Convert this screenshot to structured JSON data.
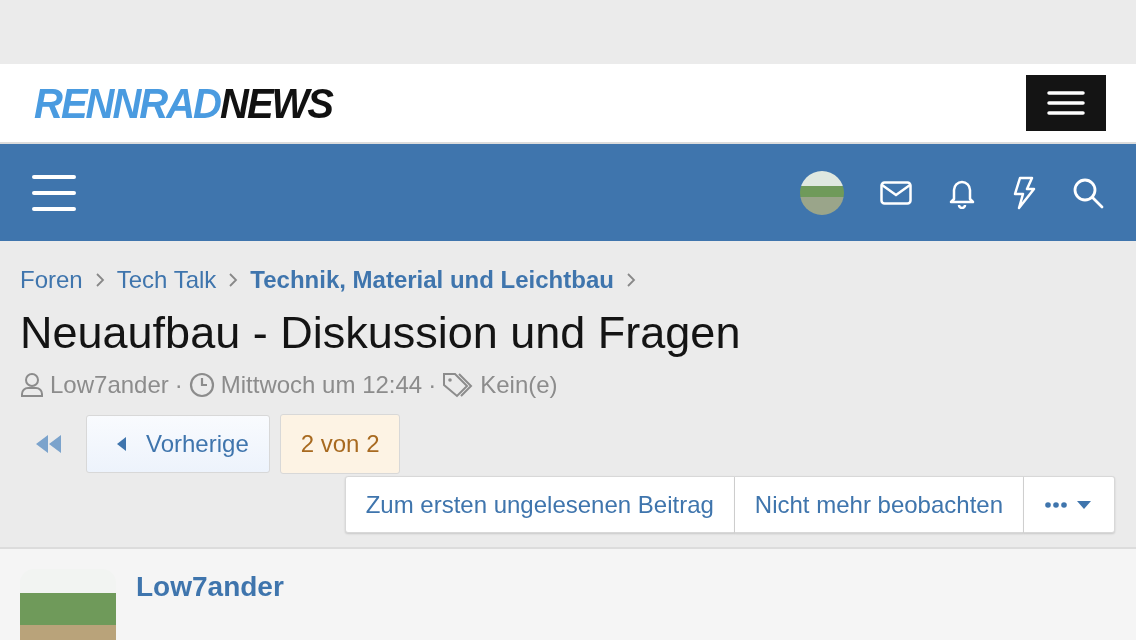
{
  "logo": {
    "part_1": "RENNRAD",
    "part_2": "NEWS"
  },
  "breadcrumbs": [
    {
      "label": "Foren",
      "current": false
    },
    {
      "label": "Tech Talk",
      "current": false
    },
    {
      "label": "Technik, Material und Leichtbau",
      "current": true
    }
  ],
  "thread": {
    "title": "Neuaufbau - Diskussion und Fragen",
    "author": "Low7ander",
    "date": "Mittwoch um 12:44",
    "tags": "Kein(e)",
    "separator_1": "·",
    "separator_2": "·"
  },
  "pagination": {
    "previous": "Vorherige",
    "page": "2 von 2"
  },
  "actions": [
    "Zum ersten ungelesenen Beitrag",
    "Nicht mehr beobachten"
  ],
  "post": {
    "author": "Low7ander"
  }
}
